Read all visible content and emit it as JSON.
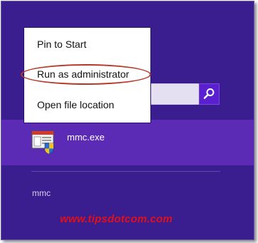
{
  "context_menu": {
    "items": [
      {
        "label": "Pin to Start"
      },
      {
        "label": "Run as administrator"
      },
      {
        "label": "Open file location"
      }
    ]
  },
  "search": {
    "value": "",
    "button_icon": "search-icon"
  },
  "results": {
    "selected": {
      "label": "mmc.exe",
      "icon": "mmc-app-icon"
    },
    "query_suggestion": "mmc"
  },
  "watermark": "www.tipsdotcom.com",
  "colors": {
    "background": "#3a1d8e",
    "selected_row": "#5b2bb5",
    "search_button": "#5a1fcf",
    "highlight_ring": "#b23a2a",
    "watermark": "#e0101a"
  }
}
